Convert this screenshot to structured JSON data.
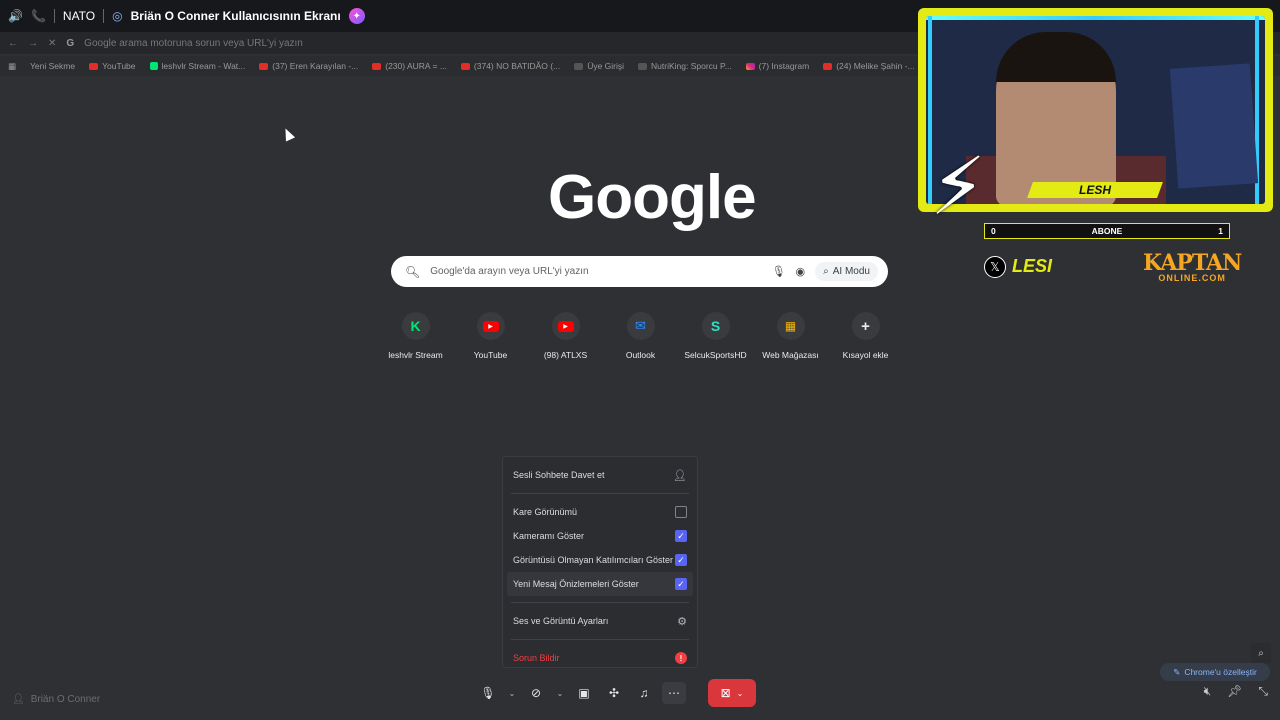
{
  "stream_bar": {
    "channel_name": "NATO",
    "stream_title": "Briän O Conner Kullanıcısının Ekranı"
  },
  "browser": {
    "omnibox_placeholder": "Google arama motoruna sorun veya URL'yi yazın",
    "bookmarks": [
      {
        "label": "Yeni Sekme",
        "icon": "none"
      },
      {
        "label": "YouTube",
        "icon": "youtube"
      },
      {
        "label": "leshvlr Stream - Wat...",
        "icon": "kick"
      },
      {
        "label": "(37) Eren Karayılan -...",
        "icon": "youtube"
      },
      {
        "label": "(230) AURA = ...",
        "icon": "youtube"
      },
      {
        "label": "(374) NO BATIDÃO (...",
        "icon": "youtube"
      },
      {
        "label": "Üye Girişi",
        "icon": "grey"
      },
      {
        "label": "NutriKing: Sporcu P...",
        "icon": "grey"
      },
      {
        "label": "(7) Instagram",
        "icon": "instagram"
      },
      {
        "label": "(24) Melike Şahin -...",
        "icon": "youtube"
      }
    ]
  },
  "google": {
    "logo": "Google",
    "search_placeholder": "Google'da arayın veya URL'yi yazın",
    "ai_mode_label": "AI Modu",
    "shortcuts": [
      {
        "label": "leshvlr Stream",
        "icon": "kick-icon"
      },
      {
        "label": "YouTube",
        "icon": "youtube-icon"
      },
      {
        "label": "(98) ATLXS",
        "icon": "youtube-icon"
      },
      {
        "label": "Outlook",
        "icon": "outlook-icon"
      },
      {
        "label": "SelcukSportsHD",
        "icon": "selcuk-icon"
      },
      {
        "label": "Web Mağazası",
        "icon": "webstore-icon"
      },
      {
        "label": "Kısayol ekle",
        "icon": "plus-icon"
      }
    ],
    "customize_label": "Chrome'u özelleştir"
  },
  "overlay": {
    "streamer_name": "LESH",
    "sub_goal_current": "0",
    "sub_goal_label": "ABONE",
    "sub_goal_target": "1",
    "social_handle": "LESI",
    "sponsor_top": "KAPTAN",
    "sponsor_bottom": "ONLINE.COM"
  },
  "context_menu": {
    "invite_label": "Sesli Sohbete Davet et",
    "items": [
      {
        "label": "Kare Görünümü",
        "checked": false
      },
      {
        "label": "Kameramı Göster",
        "checked": true
      },
      {
        "label": "Görüntüsü Olmayan Katılımcıları Göster",
        "checked": true
      },
      {
        "label": "Yeni Mesaj Önizlemeleri Göster",
        "checked": true
      }
    ],
    "settings_label": "Ses ve Görüntü Ayarları",
    "report_label": "Sorun Bildir"
  },
  "bottom": {
    "user_name": "Briän O Conner"
  }
}
